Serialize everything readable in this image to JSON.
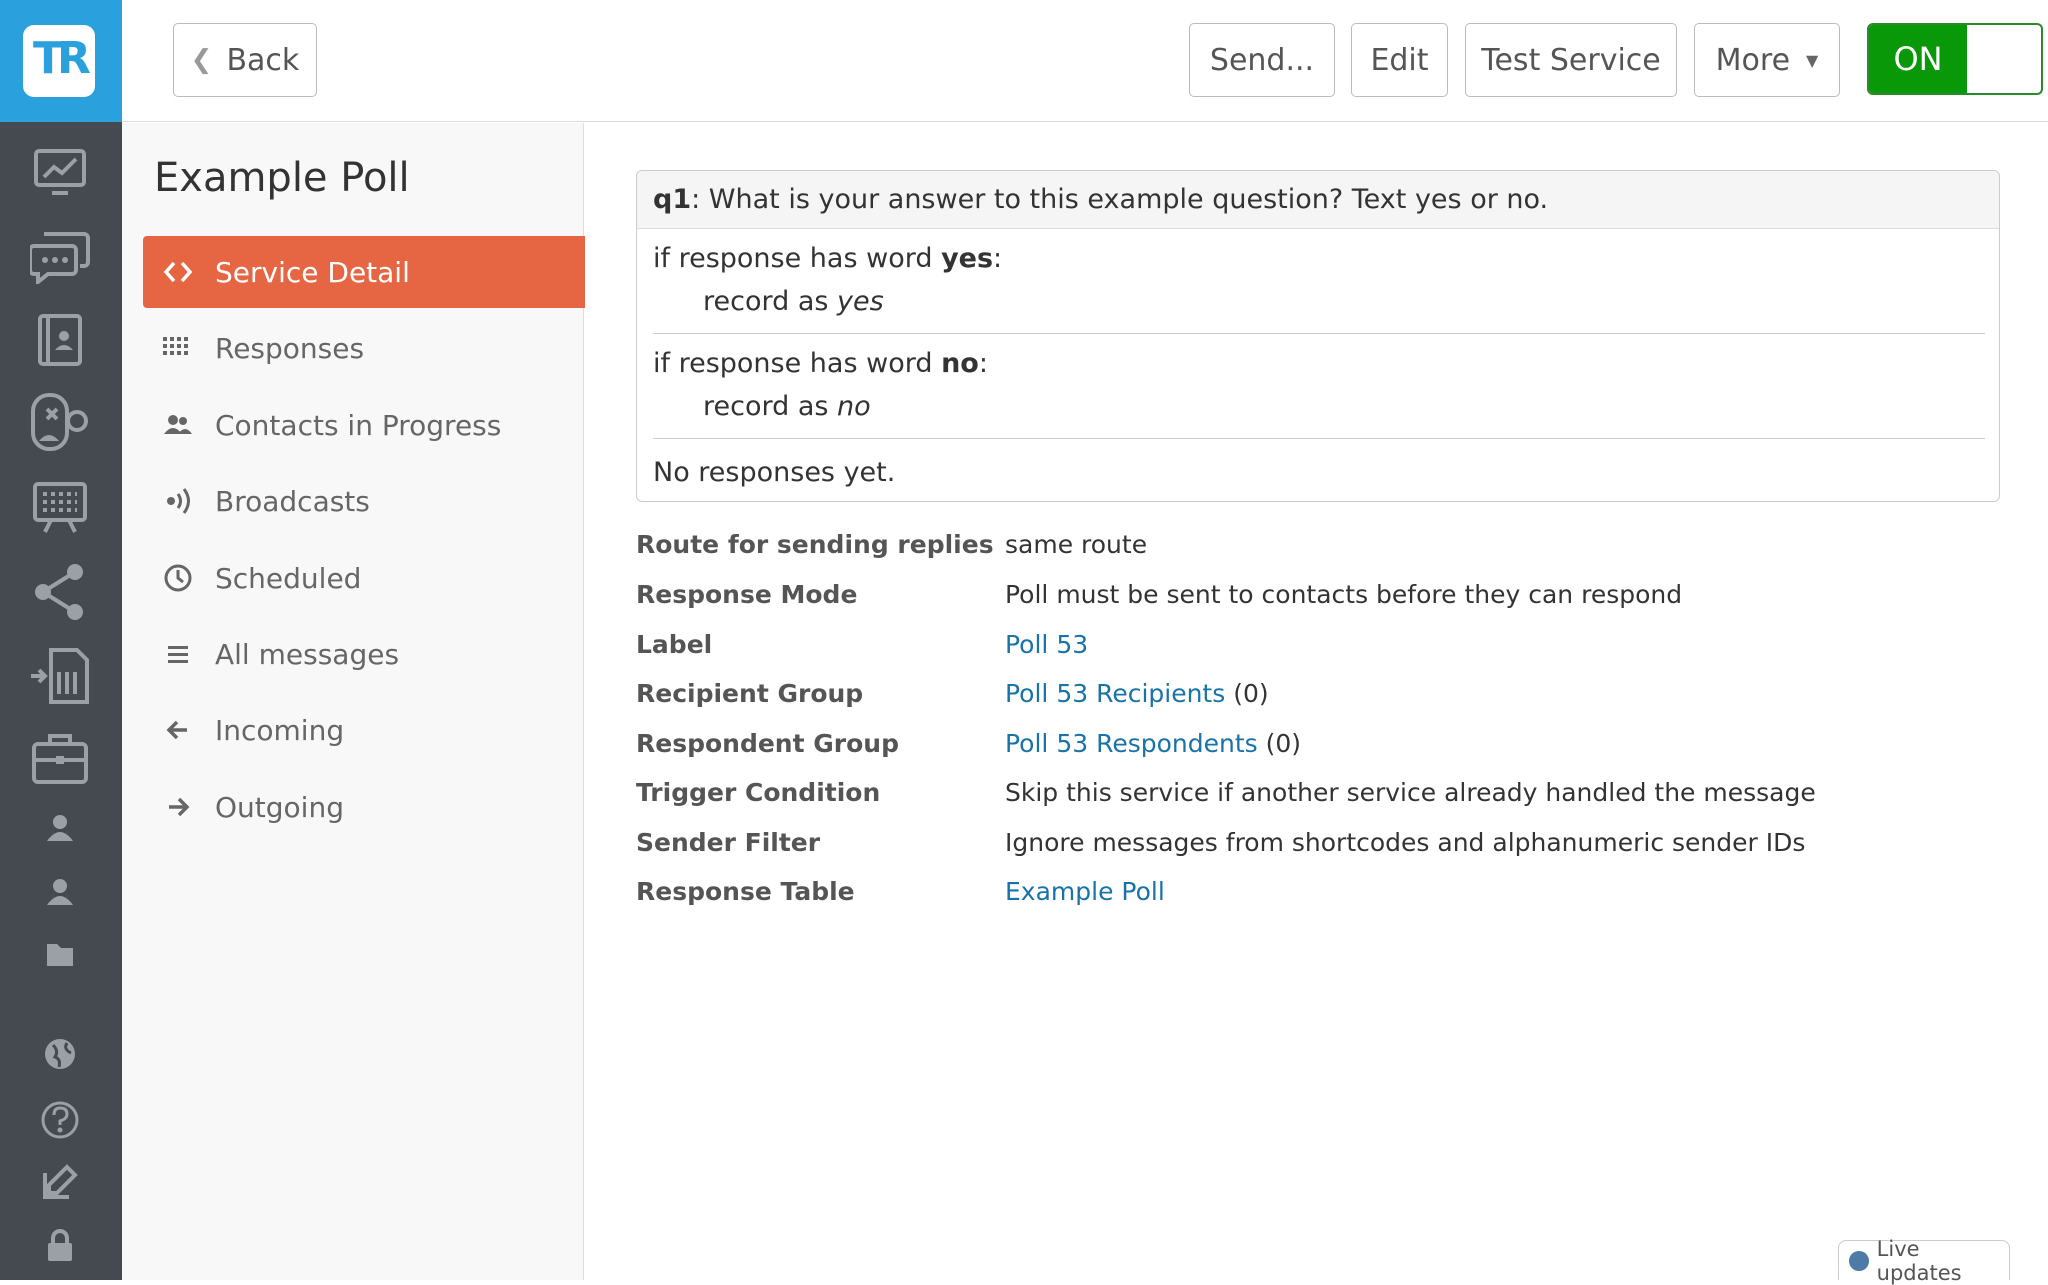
{
  "logo": {
    "text": "TR"
  },
  "toolbar": {
    "back": "Back",
    "send": "Send...",
    "edit": "Edit",
    "test": "Test Service",
    "more": "More",
    "toggle": "ON"
  },
  "sidemenu": {
    "title": "Example Poll",
    "items": [
      {
        "label": "Service Detail",
        "icon": "code-icon",
        "active": true
      },
      {
        "label": "Responses",
        "icon": "grid-icon"
      },
      {
        "label": "Contacts in Progress",
        "icon": "users-icon"
      },
      {
        "label": "Broadcasts",
        "icon": "broadcast-icon"
      },
      {
        "label": "Scheduled",
        "icon": "clock-icon"
      },
      {
        "label": "All messages",
        "icon": "list-icon"
      },
      {
        "label": "Incoming",
        "icon": "arrow-left-icon"
      },
      {
        "label": "Outgoing",
        "icon": "arrow-right-icon"
      }
    ]
  },
  "question": {
    "id": "q1",
    "text": ": What is your answer to this example question? Text yes or no.",
    "rules": [
      {
        "prefix": "if response has word ",
        "word": "yes",
        "suffix": ":",
        "action": "record as ",
        "value": "yes"
      },
      {
        "prefix": "if response has word ",
        "word": "no",
        "suffix": ":",
        "action": "record as ",
        "value": "no"
      }
    ],
    "empty": "No responses yet."
  },
  "details": [
    {
      "key": "Route for sending replies",
      "value": "same route"
    },
    {
      "key": "Response Mode",
      "value": "Poll must be sent to contacts before they can respond"
    },
    {
      "key": "Label",
      "link": "Poll 53"
    },
    {
      "key": "Recipient Group",
      "link": "Poll 53 Recipients",
      "extra": " (0)"
    },
    {
      "key": "Respondent Group",
      "link": "Poll 53 Respondents",
      "extra": " (0)"
    },
    {
      "key": "Trigger Condition",
      "value": "Skip this service if another service already handled the message"
    },
    {
      "key": "Sender Filter",
      "value": "Ignore messages from shortcodes and alphanumeric sender IDs"
    },
    {
      "key": "Response Table",
      "link": "Example Poll"
    }
  ],
  "live": "Live updates",
  "colors": {
    "accent": "#e66644",
    "brand": "#2aa0dc",
    "on": "#089808",
    "link": "#1a73a8"
  }
}
